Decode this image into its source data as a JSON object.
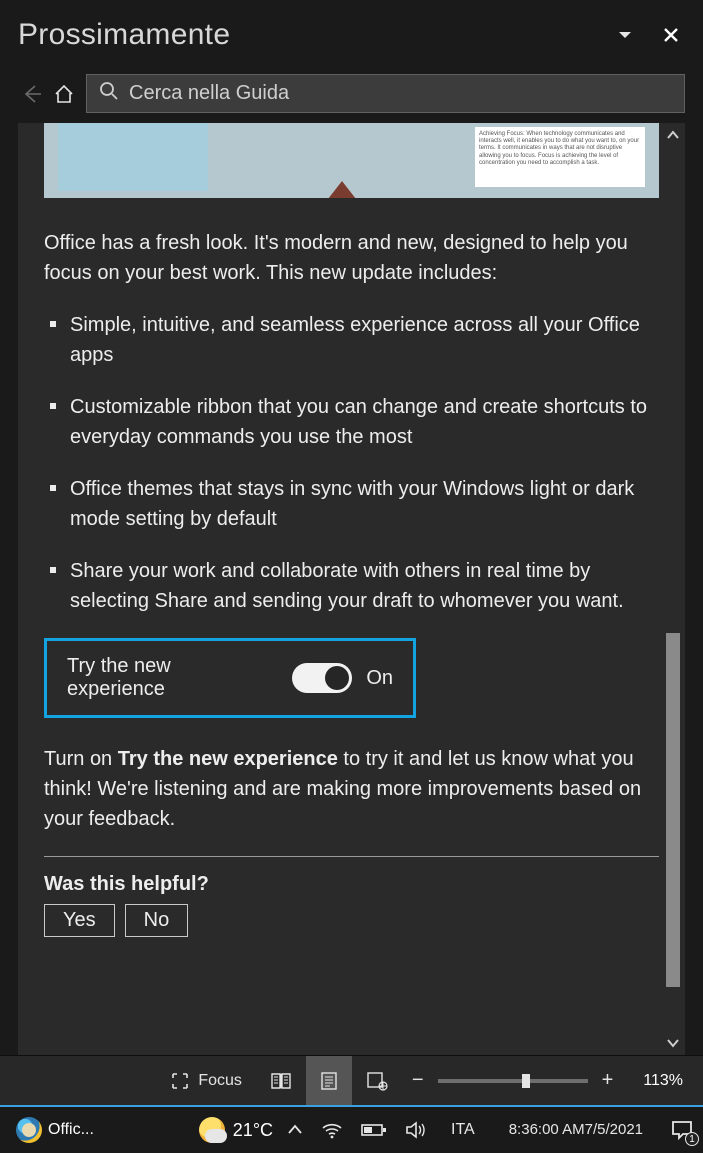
{
  "panel_title": "Prossimamente",
  "search_placeholder": "Cerca nella Guida",
  "intro": "Office has a fresh look. It's modern and new, designed to help you focus on your best work. This new update includes:",
  "features": [
    "Simple, intuitive, and seamless experience across all your Office apps",
    "Customizable ribbon that you can change and create shortcuts to everyday commands you use the most",
    "Office themes that stays in sync with your Windows light or dark mode setting by default",
    "Share your work and collaborate with others in real time by selecting Share and sending your draft to whomever you want."
  ],
  "try_box": {
    "label": "Try the new experience",
    "state": "On"
  },
  "turn_on": {
    "prefix": "Turn on ",
    "bold": "Try the new experience",
    "suffix": " to try it and let us know what you think! We're listening and are making more improvements based on your feedback."
  },
  "helpful": {
    "question": "Was this helpful?",
    "yes": "Yes",
    "no": "No"
  },
  "statusbar": {
    "focus": "Focus",
    "zoom": "113%"
  },
  "taskbar": {
    "app_label": "Offic...",
    "weather": "21°C",
    "lang": "ITA",
    "time": "8:36:00 AM",
    "date": "7/5/2021",
    "notif_count": "1"
  }
}
